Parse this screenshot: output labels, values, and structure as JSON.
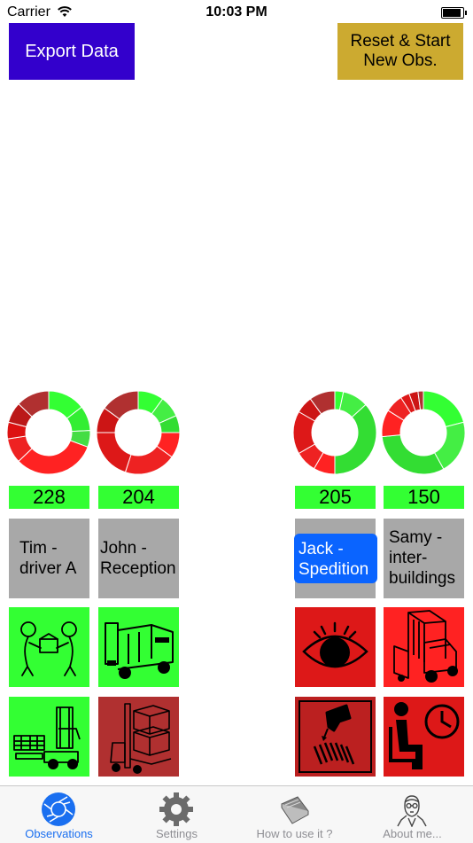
{
  "status_bar": {
    "carrier": "Carrier",
    "time": "10:03 PM"
  },
  "toolbar": {
    "export_label": "Export Data",
    "reset_line1": "Reset & Start",
    "reset_line2": "New Obs."
  },
  "operators": [
    {
      "name_line1": "Tim -",
      "name_line2": "driver A",
      "name_line3": "",
      "count": "228",
      "chart": {
        "segments": [
          {
            "value": 4.5,
            "color": "#33ff33"
          },
          {
            "value": 3,
            "color": "#33ee33"
          },
          {
            "value": 2,
            "color": "#44dd44"
          },
          {
            "value": 10,
            "color": "#ff2222"
          },
          {
            "value": 3,
            "color": "#ee2222"
          },
          {
            "value": 2,
            "color": "#dd1111"
          },
          {
            "value": 2.5,
            "color": "#bb1818"
          },
          {
            "value": 4,
            "color": "#b03030"
          }
        ]
      },
      "tile1": {
        "icon": "handover-icon",
        "color": "#33ff33"
      },
      "tile2": {
        "icon": "forklift-pallet-icon",
        "color": "#33ff33"
      }
    },
    {
      "name_line1": "John -",
      "name_line2": "Reception",
      "name_line3": "",
      "count": "204",
      "chart": {
        "segments": [
          {
            "value": 3,
            "color": "#33ff33"
          },
          {
            "value": 2.5,
            "color": "#44ee44"
          },
          {
            "value": 2,
            "color": "#33dd33"
          },
          {
            "value": 3,
            "color": "#ff2222"
          },
          {
            "value": 6,
            "color": "#ee2222"
          },
          {
            "value": 6,
            "color": "#dd1818"
          },
          {
            "value": 3,
            "color": "#cc1515"
          },
          {
            "value": 4.5,
            "color": "#b03030"
          }
        ]
      },
      "tile1": {
        "icon": "electric-truck-icon",
        "color": "#33ff33"
      },
      "tile2": {
        "icon": "forklift-boxes-icon",
        "color": "#b03030"
      }
    },
    {
      "name_line1": "Jack -",
      "name_line2": "Spedition",
      "name_line3": "",
      "count": "205",
      "selected": true,
      "chart": {
        "segments": [
          {
            "value": 1,
            "color": "#33ff33"
          },
          {
            "value": 3,
            "color": "#44ee44"
          },
          {
            "value": 11,
            "color": "#33dd33"
          },
          {
            "value": 2.5,
            "color": "#ff2222"
          },
          {
            "value": 2.5,
            "color": "#ee2222"
          },
          {
            "value": 5,
            "color": "#dd1818"
          },
          {
            "value": 2,
            "color": "#cc1515"
          },
          {
            "value": 3,
            "color": "#b03030"
          }
        ]
      },
      "tile1": {
        "icon": "eye-icon",
        "color": "#dd1818"
      },
      "tile2": {
        "icon": "barcode-scan-icon",
        "color": "#bb2020"
      }
    },
    {
      "name_line1": "Samy -",
      "name_line2": "inter-",
      "name_line3": "buildings",
      "count": "150",
      "chart": {
        "segments": [
          {
            "value": 6,
            "color": "#33ff33"
          },
          {
            "value": 6,
            "color": "#44ee44"
          },
          {
            "value": 9,
            "color": "#33dd33"
          },
          {
            "value": 3,
            "color": "#ff2222"
          },
          {
            "value": 2,
            "color": "#ee2222"
          },
          {
            "value": 1,
            "color": "#dd1818"
          },
          {
            "value": 1,
            "color": "#cc1515"
          },
          {
            "value": 0.6,
            "color": "#b03030"
          }
        ]
      },
      "tile1": {
        "icon": "forklift-icon",
        "color": "#ff2222"
      },
      "tile2": {
        "icon": "waiting-icon",
        "color": "#dd1818"
      }
    }
  ],
  "tabs": [
    {
      "label": "Observations",
      "icon": "camera-shutter-icon",
      "active": true
    },
    {
      "label": "Settings",
      "icon": "gear-icon",
      "active": false
    },
    {
      "label": "How to use it ?",
      "icon": "book-icon",
      "active": false
    },
    {
      "label": "About me...",
      "icon": "portrait-icon",
      "active": false
    }
  ]
}
